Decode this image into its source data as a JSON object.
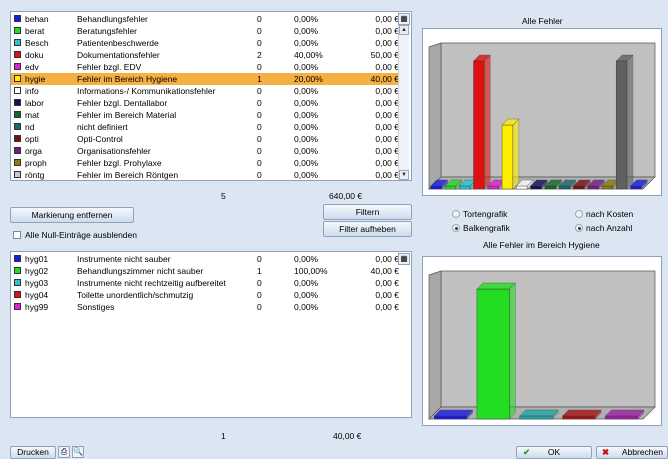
{
  "top_list": {
    "rows": [
      {
        "code": "behan",
        "desc": "Behandlungsfehler",
        "count": "0",
        "pct": "0,00%",
        "amount": "0,00 €",
        "color": "#1a1ae6"
      },
      {
        "code": "berat",
        "desc": "Beratungsfehler",
        "count": "0",
        "pct": "0,00%",
        "amount": "0,00 €",
        "color": "#22dd22"
      },
      {
        "code": "Besch",
        "desc": "Patientenbeschwerde",
        "count": "0",
        "pct": "0,00%",
        "amount": "0,00 €",
        "color": "#22c8d8"
      },
      {
        "code": "doku",
        "desc": "Dokumentationsfehler",
        "count": "2",
        "pct": "40,00%",
        "amount": "50,00 €",
        "color": "#dd1111"
      },
      {
        "code": "edv",
        "desc": "Fehler bzgl. EDV",
        "count": "0",
        "pct": "0,00%",
        "amount": "0,00 €",
        "color": "#e020d8"
      },
      {
        "code": "hygie",
        "desc": "Fehler im Bereich Hygiene",
        "count": "1",
        "pct": "20,00%",
        "amount": "40,00 €",
        "color": "#ffee00"
      },
      {
        "code": "info",
        "desc": "Informations-/ Kommunikationsfehler",
        "count": "0",
        "pct": "0,00%",
        "amount": "0,00 €",
        "color": "#ffffff"
      },
      {
        "code": "labor",
        "desc": "Fehler bzgl. Dentallabor",
        "count": "0",
        "pct": "0,00%",
        "amount": "0,00 €",
        "color": "#101060"
      },
      {
        "code": "mat",
        "desc": "Fehler im Bereich Material",
        "count": "0",
        "pct": "0,00%",
        "amount": "0,00 €",
        "color": "#0f6a2a"
      },
      {
        "code": "nd",
        "desc": "nicht definiert",
        "count": "0",
        "pct": "0,00%",
        "amount": "0,00 €",
        "color": "#1a6a6a"
      },
      {
        "code": "opti",
        "desc": "Opti-Control",
        "count": "0",
        "pct": "0,00%",
        "amount": "0,00 €",
        "color": "#7a1010"
      },
      {
        "code": "orga",
        "desc": "Organisationsfehler",
        "count": "0",
        "pct": "0,00%",
        "amount": "0,00 €",
        "color": "#7a1a8a"
      },
      {
        "code": "proph",
        "desc": "Fehler bzgl. Prohylaxe",
        "count": "0",
        "pct": "0,00%",
        "amount": "0,00 €",
        "color": "#8a7a10"
      },
      {
        "code": "röntg",
        "desc": "Fehler im Bereich Röntgen",
        "count": "0",
        "pct": "0,00%",
        "amount": "0,00 €",
        "color": "#c8c8c8"
      }
    ],
    "selected_index": 5,
    "total_count": "5",
    "total_amount": "640,00 €"
  },
  "bottom_list": {
    "rows": [
      {
        "code": "hyg01",
        "desc": "Instrumente nicht sauber",
        "count": "0",
        "pct": "0,00%",
        "amount": "0,00 €",
        "color": "#1a1ae6"
      },
      {
        "code": "hyg02",
        "desc": "Behandlungszimmer nicht sauber",
        "count": "1",
        "pct": "100,00%",
        "amount": "40,00 €",
        "color": "#22dd22"
      },
      {
        "code": "hyg03",
        "desc": "Instrumente nicht rechtzeitig aufbereitet",
        "count": "0",
        "pct": "0,00%",
        "amount": "0,00 €",
        "color": "#22c8d8"
      },
      {
        "code": "hyg04",
        "desc": "Toilette unordentlich/schmutzig",
        "count": "0",
        "pct": "0,00%",
        "amount": "0,00 €",
        "color": "#dd1111"
      },
      {
        "code": "hyg99",
        "desc": "Sonstiges",
        "count": "0",
        "pct": "0,00%",
        "amount": "0,00 €",
        "color": "#e020d8"
      }
    ],
    "total_count": "1",
    "total_amount": "40,00 €"
  },
  "buttons": {
    "markierung": "Markierung entfernen",
    "filtern": "Filtern",
    "filter_aufheben": "Filter aufheben",
    "drucken": "Drucken",
    "ok": "OK",
    "abbrechen": "Abbrechen"
  },
  "checkbox": {
    "null_eintraege": "Alle Null-Einträge ausblenden"
  },
  "radios": {
    "tortengrafik": "Tortengrafik",
    "balkengrafik": "Balkengrafik",
    "nach_kosten": "nach Kosten",
    "nach_anzahl": "nach Anzahl",
    "chart_type_selected": "Balkengrafik",
    "sort_selected": "nach Anzahl"
  },
  "icons": {
    "table_icon": "grid-icon",
    "print_icon": "printer-icon",
    "preview_icon": "preview-icon",
    "ok_icon": "check-icon",
    "cancel_icon": "x-icon"
  },
  "chart_data": [
    {
      "type": "bar",
      "title": "Alle Fehler",
      "categories": [
        "behan",
        "berat",
        "Besch",
        "doku",
        "edv",
        "hygie",
        "info",
        "labor",
        "mat",
        "nd",
        "opti",
        "orga",
        "proph",
        "röntg"
      ],
      "values": [
        0,
        0,
        0,
        2,
        0,
        1,
        0,
        0,
        0,
        0,
        0,
        0,
        0,
        2
      ],
      "colors": [
        "#1a1ae6",
        "#22dd22",
        "#22c8d8",
        "#dd1111",
        "#e020d8",
        "#ffee00",
        "#ffffff",
        "#101060",
        "#0f6a2a",
        "#1a6a6a",
        "#7a1010",
        "#7a1a8a",
        "#8a7a10",
        "#606060",
        "#1a1ae6"
      ],
      "ylim": [
        0,
        2
      ]
    },
    {
      "type": "bar",
      "title": "Alle Fehler im Bereich Hygiene",
      "categories": [
        "hyg01",
        "hyg02",
        "hyg03",
        "hyg04",
        "hyg99"
      ],
      "values": [
        0,
        1,
        0,
        0,
        0
      ],
      "colors": [
        "#1a1ae6",
        "#22dd22",
        "#22a8a8",
        "#aa1111",
        "#a020a8"
      ],
      "ylim": [
        0,
        1
      ]
    }
  ]
}
